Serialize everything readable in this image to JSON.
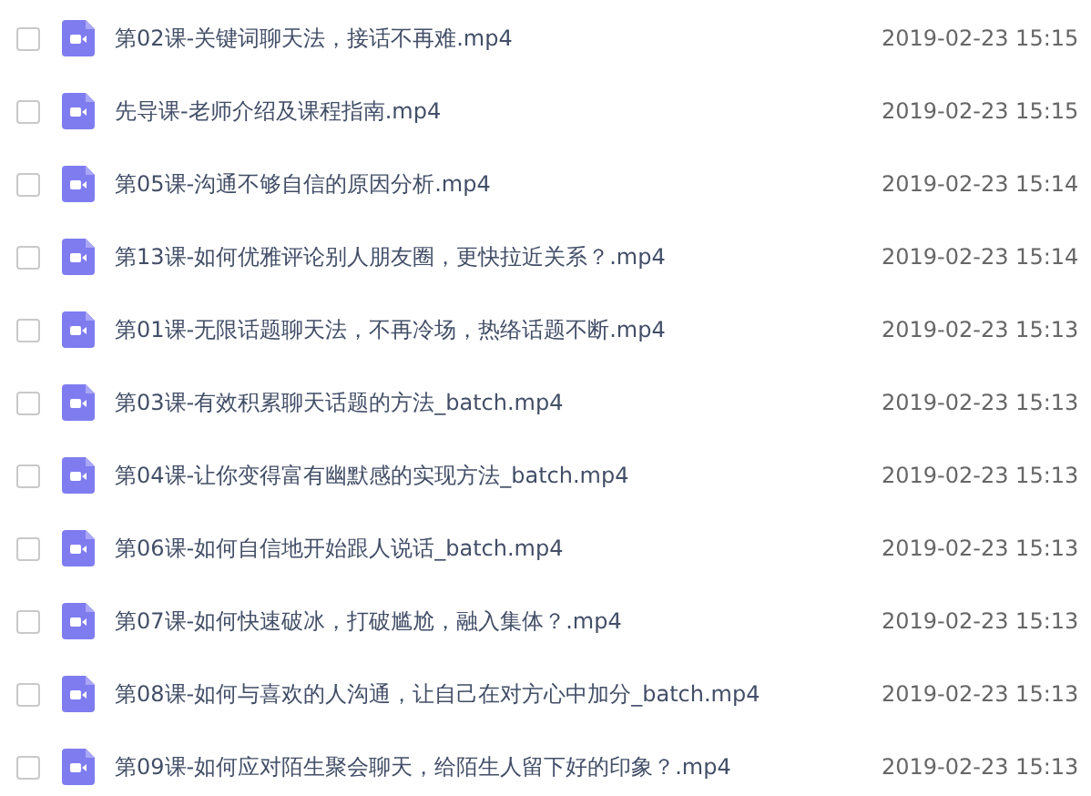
{
  "files": [
    {
      "name": "第02课-关键词聊天法，接话不再难.mp4",
      "date": "2019-02-23 15:15",
      "checked": false
    },
    {
      "name": "先导课-老师介绍及课程指南.mp4",
      "date": "2019-02-23 15:15",
      "checked": false
    },
    {
      "name": "第05课-沟通不够自信的原因分析.mp4",
      "date": "2019-02-23 15:14",
      "checked": false
    },
    {
      "name": "第13课-如何优雅评论别人朋友圈，更快拉近关系？.mp4",
      "date": "2019-02-23 15:14",
      "checked": false
    },
    {
      "name": "第01课-无限话题聊天法，不再冷场，热络话题不断.mp4",
      "date": "2019-02-23 15:13",
      "checked": false
    },
    {
      "name": "第03课-有效积累聊天话题的方法_batch.mp4",
      "date": "2019-02-23 15:13",
      "checked": false
    },
    {
      "name": "第04课-让你变得富有幽默感的实现方法_batch.mp4",
      "date": "2019-02-23 15:13",
      "checked": false
    },
    {
      "name": "第06课-如何自信地开始跟人说话_batch.mp4",
      "date": "2019-02-23 15:13",
      "checked": false
    },
    {
      "name": "第07课-如何快速破冰，打破尴尬，融入集体？.mp4",
      "date": "2019-02-23 15:13",
      "checked": false
    },
    {
      "name": "第08课-如何与喜欢的人沟通，让自己在对方心中加分_batch.mp4",
      "date": "2019-02-23 15:13",
      "checked": false
    },
    {
      "name": "第09课-如何应对陌生聚会聊天，给陌生人留下好的印象？.mp4",
      "date": "2019-02-23 15:13",
      "checked": false
    }
  ]
}
